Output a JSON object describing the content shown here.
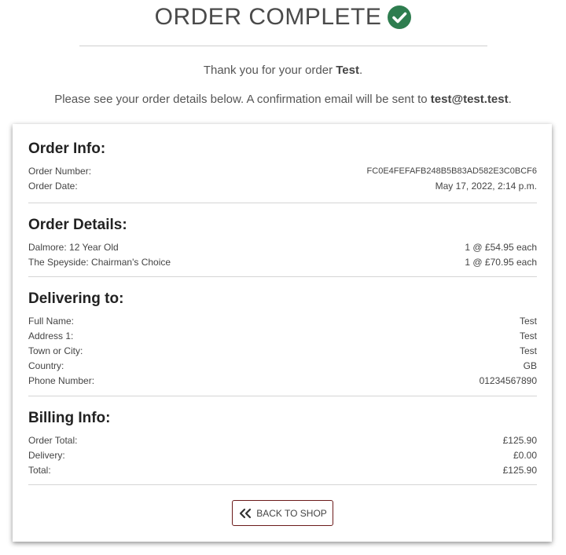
{
  "header": {
    "title": "ORDER COMPLETE",
    "thanks_prefix": "Thank you for your order ",
    "thanks_name": "Test",
    "thanks_suffix": ".",
    "confirm_prefix": "Please see your order details below. A confirmation email will be sent to ",
    "confirm_email": "test@test.test",
    "confirm_suffix": "."
  },
  "order_info": {
    "title": "Order Info:",
    "rows": [
      {
        "label": "Order Number:",
        "value": "FC0E4FEFAFB248B5B83AD582E3C0BCF6"
      },
      {
        "label": "Order Date:",
        "value": "May 17, 2022, 2:14 p.m."
      }
    ]
  },
  "order_details": {
    "title": "Order Details:",
    "rows": [
      {
        "label": "Dalmore: 12 Year Old",
        "value": "1 @ £54.95 each"
      },
      {
        "label": "The Speyside: Chairman's Choice",
        "value": "1 @ £70.95 each"
      }
    ]
  },
  "delivering_to": {
    "title": "Delivering to:",
    "rows": [
      {
        "label": "Full Name:",
        "value": "Test"
      },
      {
        "label": "Address 1:",
        "value": "Test"
      },
      {
        "label": "Town or City:",
        "value": "Test"
      },
      {
        "label": "Country:",
        "value": "GB"
      },
      {
        "label": "Phone Number:",
        "value": "01234567890"
      }
    ]
  },
  "billing_info": {
    "title": "Billing Info:",
    "rows": [
      {
        "label": "Order Total:",
        "value": "£125.90"
      },
      {
        "label": "Delivery:",
        "value": "£0.00"
      },
      {
        "label": "Total:",
        "value": "£125.90"
      }
    ]
  },
  "actions": {
    "back_label": "BACK TO SHOP"
  },
  "icons": {
    "title_icon": "check-circle-icon",
    "back_icon": "double-chevron-left-icon"
  },
  "colors": {
    "check_green": "#2e7d4f",
    "button_border": "#6b1a1a"
  }
}
